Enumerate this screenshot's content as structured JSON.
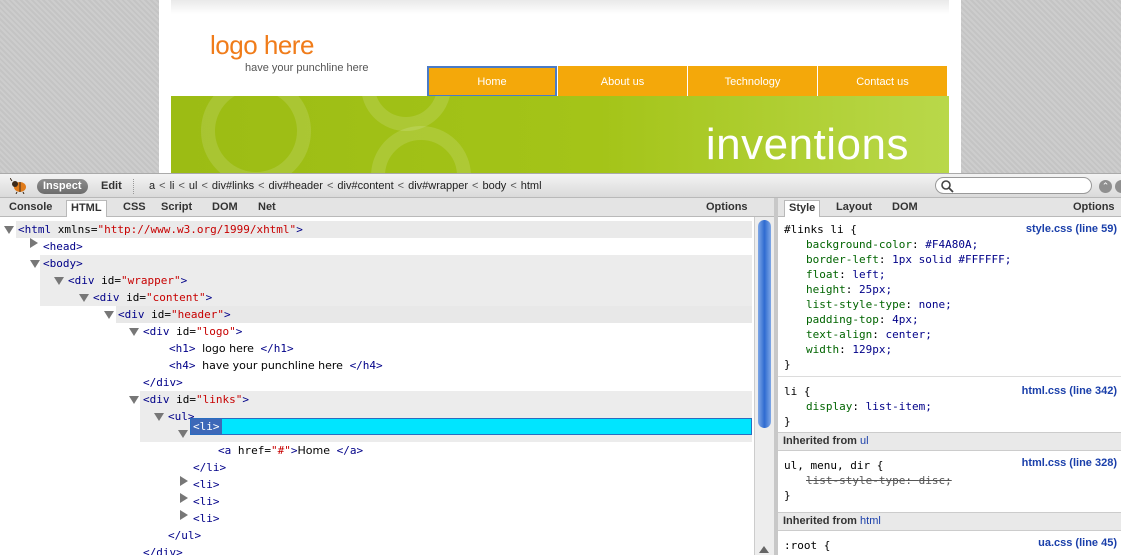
{
  "site": {
    "logo": "logo here",
    "punchline": "have your punchline here",
    "nav": [
      "Home",
      "About us",
      "Technology",
      "Contact us"
    ],
    "banner_title": "inventions",
    "colors": {
      "nav_bg": "#F4A80A",
      "logo": "#f07c1a",
      "banner": "#9cbc14"
    }
  },
  "firebug": {
    "toolbar": {
      "inspect": "Inspect",
      "edit": "Edit",
      "breadcrumb": [
        "a",
        "li",
        "ul",
        "div#links",
        "div#header",
        "div#content",
        "div#wrapper",
        "body",
        "html"
      ],
      "search_value": ""
    },
    "left_tabs": [
      "Console",
      "HTML",
      "CSS",
      "Script",
      "DOM",
      "Net"
    ],
    "left_options": "Options",
    "right_tabs": [
      "Style",
      "Layout",
      "DOM"
    ],
    "right_options": "Options",
    "tree": {
      "html_open": "<html",
      "html_attr": "xmlns=",
      "html_attr_val": "\"http://www.w3.org/1999/xhtml\"",
      "head": "<head>",
      "body": "<body>",
      "div": "<div",
      "id_attr": "id=",
      "wrapper": "\"wrapper\"",
      "content": "\"content\"",
      "header": "\"header\"",
      "logo": "\"logo\"",
      "links": "\"links\"",
      "gt": ">",
      "h1_open": "<h1>",
      "h1_text": "logo here",
      "h1_close": "</h1>",
      "h4_open": "<h4>",
      "h4_text": "have your punchline here",
      "h4_close": "</h4>",
      "div_close": "</div>",
      "ul_open": "<ul>",
      "li_open": "<li>",
      "a_open": "<a",
      "href_attr": "href=",
      "href_val": "\"#\"",
      "a_text": "Home",
      "a_close": "</a>",
      "li_close": "</li>",
      "ul_close": "</ul>"
    },
    "styles": {
      "rule1": {
        "selector": "#links li {",
        "source": "style.css (line 59)",
        "props": [
          {
            "name": "background-color",
            "value": "#F4A80A;"
          },
          {
            "name": "border-left",
            "value": "1px solid #FFFFFF;"
          },
          {
            "name": "float",
            "value": "left;"
          },
          {
            "name": "height",
            "value": "25px;"
          },
          {
            "name": "list-style-type",
            "value": "none;"
          },
          {
            "name": "padding-top",
            "value": "4px;"
          },
          {
            "name": "text-align",
            "value": "center;"
          },
          {
            "name": "width",
            "value": "129px;"
          }
        ],
        "close": "}"
      },
      "rule2": {
        "selector": "li {",
        "source": "html.css (line 342)",
        "prop_name": "display",
        "prop_value": "list-item;",
        "close": "}"
      },
      "inherited_ul": {
        "label": "Inherited from",
        "link": "ul"
      },
      "rule3": {
        "selector": "ul, menu, dir {",
        "source": "html.css (line 328)",
        "prop_name": "list-style-type",
        "prop_value": "disc;",
        "close": "}"
      },
      "inherited_html": {
        "label": "Inherited from",
        "link": "html"
      },
      "rule4": {
        "selector": ":root {",
        "source": "ua.css (line 45)"
      }
    }
  }
}
